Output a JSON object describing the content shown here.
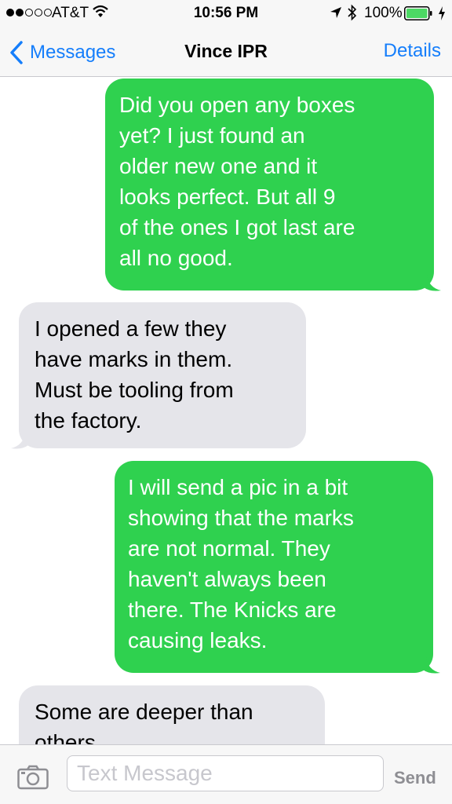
{
  "status_bar": {
    "carrier": "AT&T",
    "time": "10:56 PM",
    "battery": "100%",
    "signal_bars_filled": 2,
    "signal_bars_total": 5,
    "icons": [
      "wifi-icon",
      "location-icon",
      "bluetooth-icon",
      "battery-icon",
      "charging-icon"
    ]
  },
  "nav": {
    "back_label": "Messages",
    "title": "Vince IPR",
    "details_label": "Details"
  },
  "messages": [
    {
      "direction": "outgoing",
      "text": "Did you open any boxes\nyet?  I just found an\nolder new one and it\nlooks perfect.  But all 9\nof the ones I got last are\nall no good."
    },
    {
      "direction": "incoming",
      "text": "I opened a few they\nhave marks in them.\nMust be tooling from\nthe factory."
    },
    {
      "direction": "outgoing",
      "text": "I will send a pic in a bit\nshowing that the marks\nare not normal.  They\nhaven't always been\nthere.   The Knicks are\ncausing leaks."
    },
    {
      "direction": "incoming",
      "text": "Some are deeper than\nothers"
    }
  ],
  "input_bar": {
    "placeholder": "Text Message",
    "value": "",
    "send_label": "Send",
    "camera_icon": "camera-icon"
  },
  "colors": {
    "accent": "#157efb",
    "outgoing_bubble": "#2fd14f",
    "incoming_bubble": "#e5e5ea",
    "send_disabled": "#8e8e93"
  }
}
